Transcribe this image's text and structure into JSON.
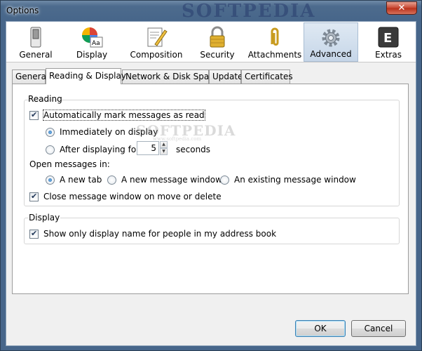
{
  "window": {
    "title": "Options",
    "watermark": "SOFTPEDIA",
    "close_label": "✕"
  },
  "panes": [
    {
      "label": "General"
    },
    {
      "label": "Display"
    },
    {
      "label": "Composition"
    },
    {
      "label": "Security"
    },
    {
      "label": "Attachments"
    },
    {
      "label": "Advanced",
      "selected": true
    },
    {
      "label": "Extras"
    }
  ],
  "tabs": [
    {
      "label": "General"
    },
    {
      "label": "Reading & Display",
      "active": true
    },
    {
      "label": "Network & Disk Space"
    },
    {
      "label": "Update"
    },
    {
      "label": "Certificates"
    }
  ],
  "reading": {
    "heading": "Reading",
    "auto_mark": {
      "label": "Automatically mark messages as read",
      "checked": true
    },
    "immediately": {
      "label": "Immediately on display",
      "selected": true
    },
    "after_delay": {
      "label_before": "After displaying for",
      "value": "5",
      "label_after": "seconds",
      "selected": false
    },
    "open_heading": "Open messages in:",
    "open_options": [
      {
        "label": "A new tab",
        "selected": true
      },
      {
        "label": "A new message window",
        "selected": false
      },
      {
        "label": "An existing message window",
        "selected": false
      }
    ],
    "close_window": {
      "label": "Close message window on move or delete",
      "checked": true
    }
  },
  "display": {
    "heading": "Display",
    "show_name": {
      "label": "Show only display name for people in my address book",
      "checked": true
    }
  },
  "center_watermark": "SOFTPEDIA",
  "center_watermark_url": "www.softpedia.com",
  "buttons": {
    "ok": "OK",
    "cancel": "Cancel"
  },
  "colors": {
    "selected_pane": "#c6d6e8",
    "frame": "#4d6b8d"
  }
}
